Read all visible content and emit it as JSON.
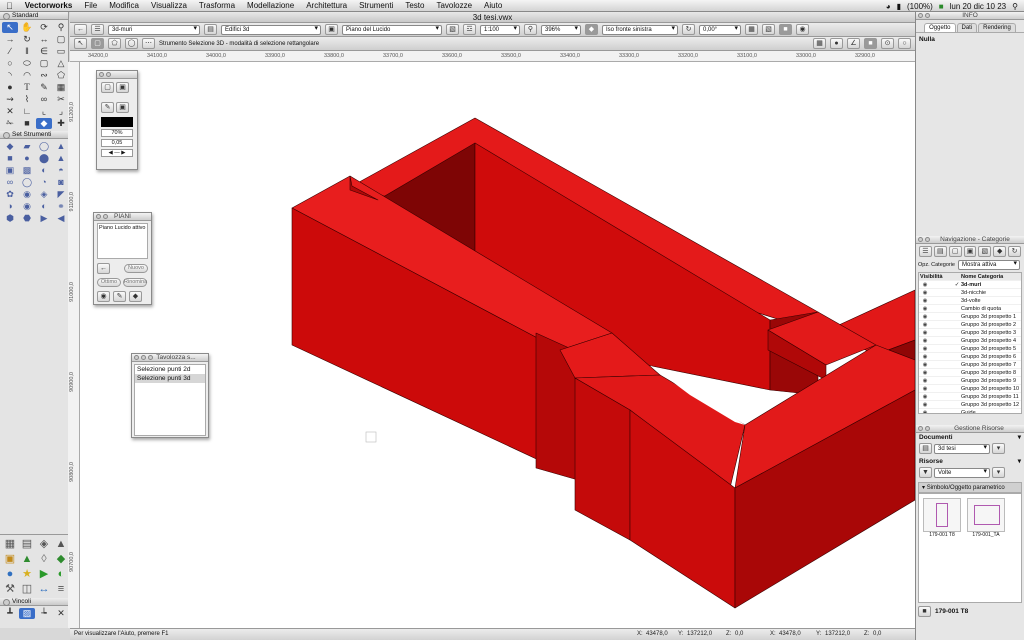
{
  "menubar": {
    "apple": "",
    "items": [
      "Vectorworks",
      "File",
      "Modifica",
      "Visualizza",
      "Trasforma",
      "Modellazione",
      "Architettura",
      "Strumenti",
      "Testo",
      "Tavolozze",
      "Aiuto"
    ],
    "battery": "(100%)",
    "clock": "lun 20 dic  10 23"
  },
  "window": {
    "title": "3d tesi.vwx"
  },
  "toolbar1": {
    "class_dd": "3d-muri",
    "layer_dd": "Edifici 3d",
    "tracing_dd": "Piano del Lucido",
    "scale": "1:100",
    "zoom": "396%",
    "view_dd": "Iso fronte sinistra",
    "angle": "0,00°"
  },
  "toolbar2": {
    "mode_text": "Strumento Selezione 3D - modalità di selezione rettangolare"
  },
  "hruler": [
    "34200,0",
    "34100,0",
    "34000,0",
    "33900,0",
    "33800,0",
    "33700,0",
    "33600,0",
    "33500,0",
    "33400,0",
    "33300,0",
    "33200,0",
    "33100,0",
    "33000,0",
    "32900,0"
  ],
  "vruler": [
    "91200,0",
    "91100,0",
    "91000,0",
    "90900,0",
    "90800,0",
    "90700,0"
  ],
  "palettes": {
    "standard": "Standard",
    "set_strumenti": "Set Strumenti",
    "vincoli": "Vincoli"
  },
  "attributes": {
    "opacity": "70%",
    "line": "0,05"
  },
  "piani": {
    "title": "PIANI",
    "item": "Piano Lucido attivo",
    "btn_new": "Nuovo",
    "btn_other": "Ottimo",
    "btn_rename": "Rinomina"
  },
  "tavolozza": {
    "title": "Tavolozza s...",
    "items": [
      "Selezione punti 2d",
      "Selezione punti 3d"
    ]
  },
  "info": {
    "title": "INFO",
    "tabs": [
      "Oggetto",
      "Dati",
      "Rendering"
    ],
    "value": "Nulla"
  },
  "navigation": {
    "title": "Navigazione - Categorie",
    "opt_label": "Opz. Categorie",
    "opt_value": "Mostra attiva",
    "col_vis": "Visibilità",
    "col_name": "Nome Categoria",
    "rows": [
      "3d-muri",
      "3d-nicchie",
      "3d-volte",
      "Cambio di quota",
      "Gruppo 3d prospetto 1",
      "Gruppo 3d prospetto 2",
      "Gruppo 3d prospetto 3",
      "Gruppo 3d prospetto 4",
      "Gruppo 3d prospetto 5",
      "Gruppo 3d prospetto 6",
      "Gruppo 3d prospetto 7",
      "Gruppo 3d prospetto 8",
      "Gruppo 3d prospetto 9",
      "Gruppo 3d prospetto 10",
      "Gruppo 3d prospetto 11",
      "Gruppo 3d prospetto 12",
      "Guide"
    ]
  },
  "resources": {
    "title": "Gestione Risorse",
    "documents_label": "Documenti",
    "document": "3d tesi",
    "resources_label": "Risorse",
    "filter": "Volte",
    "group": "Simbolo/Oggetto parametrico",
    "thumbs": [
      "179-001 T8",
      "179-001_TA"
    ],
    "selected": "179-001 T8"
  },
  "status": {
    "help": "Per visualizzare l'Aiuto, premere F1",
    "x_label": "X:",
    "x": "43478,0",
    "y_label": "Y:",
    "y": "137212,0",
    "z_label": "Z:",
    "z": "0,0",
    "x2": "43478,0",
    "y2": "137212,0",
    "z2": "0,0"
  },
  "colors": {
    "wall_front": "#cc0a0a",
    "wall_top": "#e21a1a",
    "wall_side": "#a80707",
    "wall_inner": "#7a0505"
  }
}
